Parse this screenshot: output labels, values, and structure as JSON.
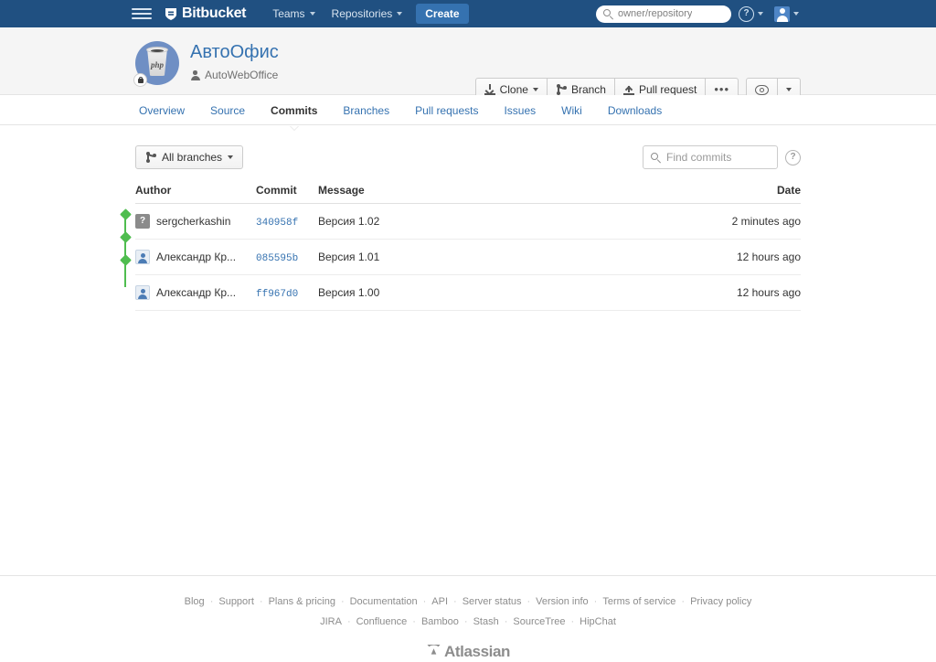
{
  "topnav": {
    "menu_icon": "hamburger-icon",
    "brand": "Bitbucket",
    "links": [
      {
        "label": "Teams",
        "has_caret": true
      },
      {
        "label": "Repositories",
        "has_caret": true
      }
    ],
    "create_label": "Create",
    "search_placeholder": "owner/repository",
    "help_glyph": "?",
    "profile_icon": "user-avatar-icon"
  },
  "repo": {
    "name": "АвтоОфис",
    "owner": "AutoWebOffice",
    "avatar_label": "php",
    "private": true,
    "actions": [
      {
        "label": "Clone",
        "icon": "download-icon",
        "has_caret": true
      },
      {
        "label": "Branch",
        "icon": "branch-icon",
        "has_caret": false
      },
      {
        "label": "Pull request",
        "icon": "upload-icon",
        "has_caret": false
      },
      {
        "label": "•••",
        "icon": "ellipsis-icon",
        "has_caret": false
      }
    ],
    "watch": {
      "icon": "eye-icon",
      "has_caret": true
    }
  },
  "tabs": [
    {
      "label": "Overview",
      "active": false
    },
    {
      "label": "Source",
      "active": false
    },
    {
      "label": "Commits",
      "active": true
    },
    {
      "label": "Branches",
      "active": false
    },
    {
      "label": "Pull requests",
      "active": false
    },
    {
      "label": "Issues",
      "active": false
    },
    {
      "label": "Wiki",
      "active": false
    },
    {
      "label": "Downloads",
      "active": false
    }
  ],
  "toolbar": {
    "branch_filter": "All branches",
    "branch_icon": "branch-icon",
    "find_placeholder": "Find commits",
    "find_value": "",
    "help_glyph": "?"
  },
  "commits_table": {
    "columns": [
      "Author",
      "Commit",
      "Message",
      "Date"
    ],
    "rows": [
      {
        "avatar_type": "unknown",
        "avatar_glyph": "?",
        "author": "sergcherkashin",
        "hash": "340958f",
        "message": "Версия 1.02",
        "date": "2 minutes ago"
      },
      {
        "avatar_type": "user",
        "avatar_glyph": "",
        "author": "Александр Кр...",
        "hash": "085595b",
        "message": "Версия 1.01",
        "date": "12 hours ago"
      },
      {
        "avatar_type": "user",
        "avatar_glyph": "",
        "author": "Александр Кр...",
        "hash": "ff967d0",
        "message": "Версия 1.00",
        "date": "12 hours ago"
      }
    ]
  },
  "footer": {
    "row1": [
      "Blog",
      "Support",
      "Plans & pricing",
      "Documentation",
      "API",
      "Server status",
      "Version info",
      "Terms of service",
      "Privacy policy"
    ],
    "row2": [
      "JIRA",
      "Confluence",
      "Bamboo",
      "Stash",
      "SourceTree",
      "HipChat"
    ],
    "brand": "Atlassian"
  },
  "colors": {
    "nav_bg": "#205081",
    "accent_blue": "#3572b0",
    "graph_green": "#4fbd4f",
    "header_bg": "#f5f5f5"
  }
}
